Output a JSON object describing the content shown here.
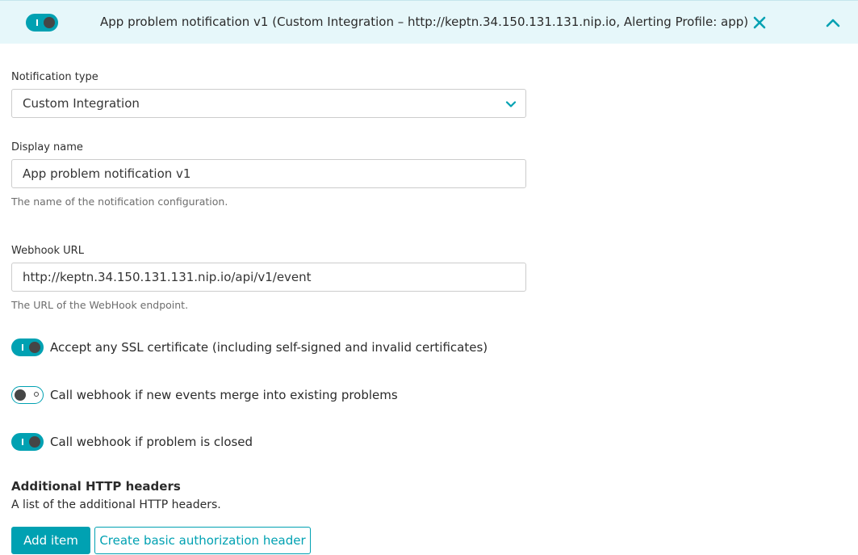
{
  "header": {
    "enabled": true,
    "title": "App problem notification v1 (Custom Integration – http://keptn.34.150.131.131.nip.io, Alerting Profile: app)",
    "close_icon": "close-icon",
    "collapse_icon": "chevron-up-icon"
  },
  "form": {
    "notification_type": {
      "label": "Notification type",
      "value": "Custom Integration",
      "icon": "chevron-down-icon"
    },
    "display_name": {
      "label": "Display name",
      "value": "App problem notification v1",
      "hint": "The name of the notification configuration."
    },
    "webhook_url": {
      "label": "Webhook URL",
      "value": "http://keptn.34.150.131.131.nip.io/api/v1/event",
      "hint": "The URL of the WebHook endpoint."
    },
    "toggles": [
      {
        "label": "Accept any SSL certificate (including self-signed and invalid certificates)",
        "on": true
      },
      {
        "label": "Call webhook if new events merge into existing problems",
        "on": false
      },
      {
        "label": "Call webhook if problem is closed",
        "on": true
      }
    ]
  },
  "headers_section": {
    "title": "Additional HTTP headers",
    "description": "A list of the additional HTTP headers.",
    "add_item_label": "Add item",
    "basic_auth_label": "Create basic authorization header"
  },
  "colors": {
    "accent": "#00a1b2",
    "header_bg": "#e6f7fa"
  }
}
